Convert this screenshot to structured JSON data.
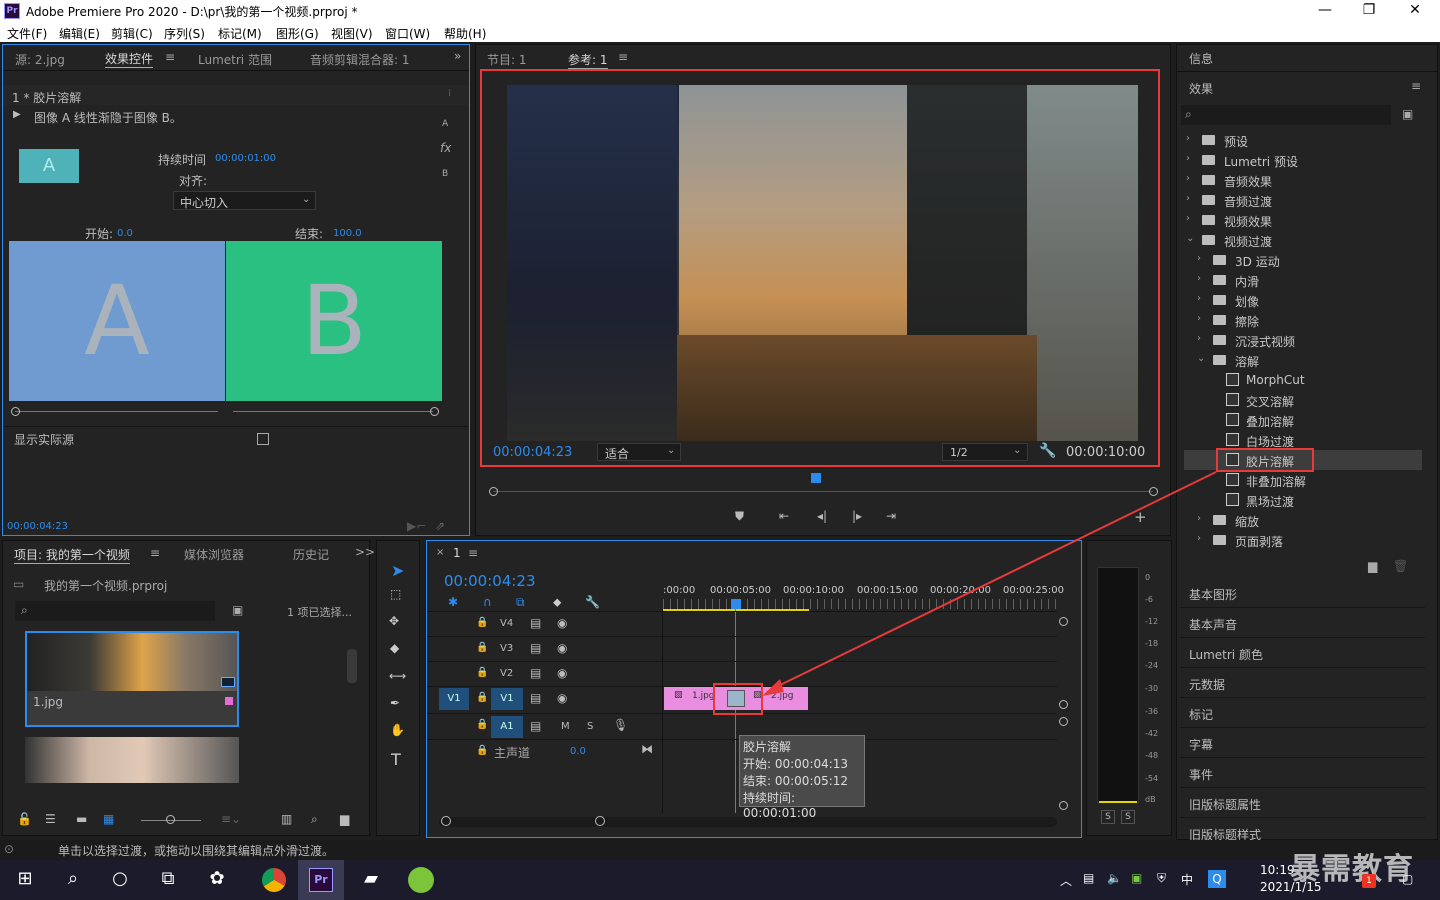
{
  "window": {
    "title": "Adobe Premiere Pro 2020 - D:\\pr\\我的第一个视频.prproj *",
    "app_icon": "Pr"
  },
  "menu": [
    "文件(F)",
    "编辑(E)",
    "剪辑(C)",
    "序列(S)",
    "标记(M)",
    "图形(G)",
    "视图(V)",
    "窗口(W)",
    "帮助(H)"
  ],
  "source_panel": {
    "tabs": [
      "源: 2.jpg",
      "效果控件",
      "Lumetri 范围",
      "音频剪辑混合器: 1"
    ],
    "clip_header": "1 * 胶片溶解",
    "desc": "图像 A 线性渐隐于图像 B。",
    "thumb_letter": "A",
    "duration_label": "持续时间",
    "duration_value": "00:00:01:00",
    "align_label": "对齐:",
    "align_value": "中心切入",
    "start_label": "开始:",
    "start_value": "0.0",
    "end_label": "结束:",
    "end_value": "100.0",
    "a_letter": "A",
    "b_letter": "B",
    "side_a": "A",
    "side_b": "B",
    "fx": "fx",
    "show_actual": "显示实际源",
    "timecode": "00:00:04:23"
  },
  "program_panel": {
    "tabs": [
      "节目: 1",
      "参考: 1"
    ],
    "timecode": "00:00:04:23",
    "fit": "适合",
    "resolution": "1/2",
    "duration": "00:00:10:00"
  },
  "project_panel": {
    "tabs": [
      "项目: 我的第一个视频",
      "媒体浏览器",
      "历史记",
      ">>"
    ],
    "file": "我的第一个视频.prproj",
    "selected": "1 项已选择...",
    "item1": "1.jpg"
  },
  "timeline": {
    "tab": "1",
    "timecode": "00:00:04:23",
    "ruler": [
      ":00:00",
      "00:00:05:00",
      "00:00:10:00",
      "00:00:15:00",
      "00:00:20:00",
      "00:00:25:00"
    ],
    "tracks": [
      "V4",
      "V3",
      "V2",
      "V1",
      "A1"
    ],
    "src_v1": "V1",
    "master": "主声道",
    "master_value": "0.0",
    "m": "M",
    "s": "S",
    "clip1": "1.jpg",
    "clip2": "2.jpg",
    "tooltip": {
      "name": "胶片溶解",
      "start": "开始: 00:00:04:13",
      "end": "结束: 00:00:05:12",
      "duration": "持续时间: 00:00:01:00"
    }
  },
  "meter": {
    "scale": [
      "0",
      "-6",
      "-12",
      "-18",
      "-24",
      "-30",
      "-36",
      "-42",
      "-48",
      "-54",
      "dB"
    ],
    "solo": [
      "S",
      "S"
    ]
  },
  "right_panel": {
    "info": "信息",
    "effects": "效果",
    "tree": [
      {
        "label": "预设",
        "level": 0,
        "type": "folder"
      },
      {
        "label": "Lumetri 预设",
        "level": 0,
        "type": "folder"
      },
      {
        "label": "音频效果",
        "level": 0,
        "type": "folder"
      },
      {
        "label": "音频过渡",
        "level": 0,
        "type": "folder"
      },
      {
        "label": "视频效果",
        "level": 0,
        "type": "folder"
      },
      {
        "label": "视频过渡",
        "level": 0,
        "type": "folder",
        "open": true
      },
      {
        "label": "3D 运动",
        "level": 1,
        "type": "folder"
      },
      {
        "label": "内滑",
        "level": 1,
        "type": "folder"
      },
      {
        "label": "划像",
        "level": 1,
        "type": "folder"
      },
      {
        "label": "擦除",
        "level": 1,
        "type": "folder"
      },
      {
        "label": "沉浸式视频",
        "level": 1,
        "type": "folder"
      },
      {
        "label": "溶解",
        "level": 1,
        "type": "folder",
        "open": true
      },
      {
        "label": "MorphCut",
        "level": 2,
        "type": "file"
      },
      {
        "label": "交叉溶解",
        "level": 2,
        "type": "file"
      },
      {
        "label": "叠加溶解",
        "level": 2,
        "type": "file"
      },
      {
        "label": "白场过渡",
        "level": 2,
        "type": "file"
      },
      {
        "label": "胶片溶解",
        "level": 2,
        "type": "file",
        "selected": true
      },
      {
        "label": "非叠加溶解",
        "level": 2,
        "type": "file"
      },
      {
        "label": "黑场过渡",
        "level": 2,
        "type": "file"
      },
      {
        "label": "缩放",
        "level": 1,
        "type": "folder"
      },
      {
        "label": "页面剥落",
        "level": 1,
        "type": "folder"
      }
    ],
    "panels": [
      "基本图形",
      "基本声音",
      "Lumetri 颜色",
      "元数据",
      "标记",
      "字幕",
      "事件",
      "旧版标题属性",
      "旧版标题样式"
    ]
  },
  "status_bar": "单击以选择过渡，或拖动以围绕其编辑点外滑过渡。",
  "taskbar": {
    "time": "10:19",
    "date": "2021/1/15",
    "ime": "中",
    "watermark": "暴需教育"
  }
}
